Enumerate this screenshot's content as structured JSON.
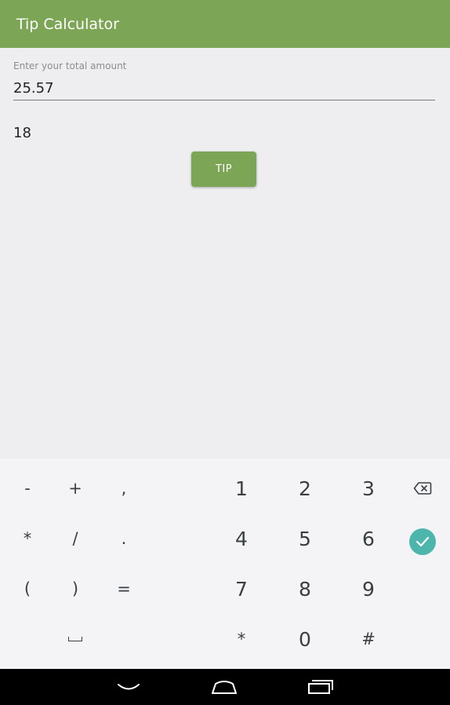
{
  "app_bar": {
    "title": "Tip Calculator",
    "color": "#7ca656"
  },
  "form": {
    "amount_hint": "Enter your total amount",
    "amount_value": "25.57",
    "tip_percent": "18",
    "tip_button_label": "TIP"
  },
  "keyboard": {
    "symbol_keys": [
      "-",
      "+",
      ",",
      "*",
      "/",
      ".",
      "(",
      ")",
      "="
    ],
    "number_keys": [
      "1",
      "2",
      "3",
      "4",
      "5",
      "6",
      "7",
      "8",
      "9",
      "*",
      "0",
      "#"
    ],
    "icons": [
      "backspace-icon",
      "done-icon",
      "space-icon"
    ],
    "done_color": "#4db6ac"
  },
  "nav_bar": {
    "icons": [
      "back-icon",
      "home-icon",
      "recent-apps-icon"
    ]
  }
}
